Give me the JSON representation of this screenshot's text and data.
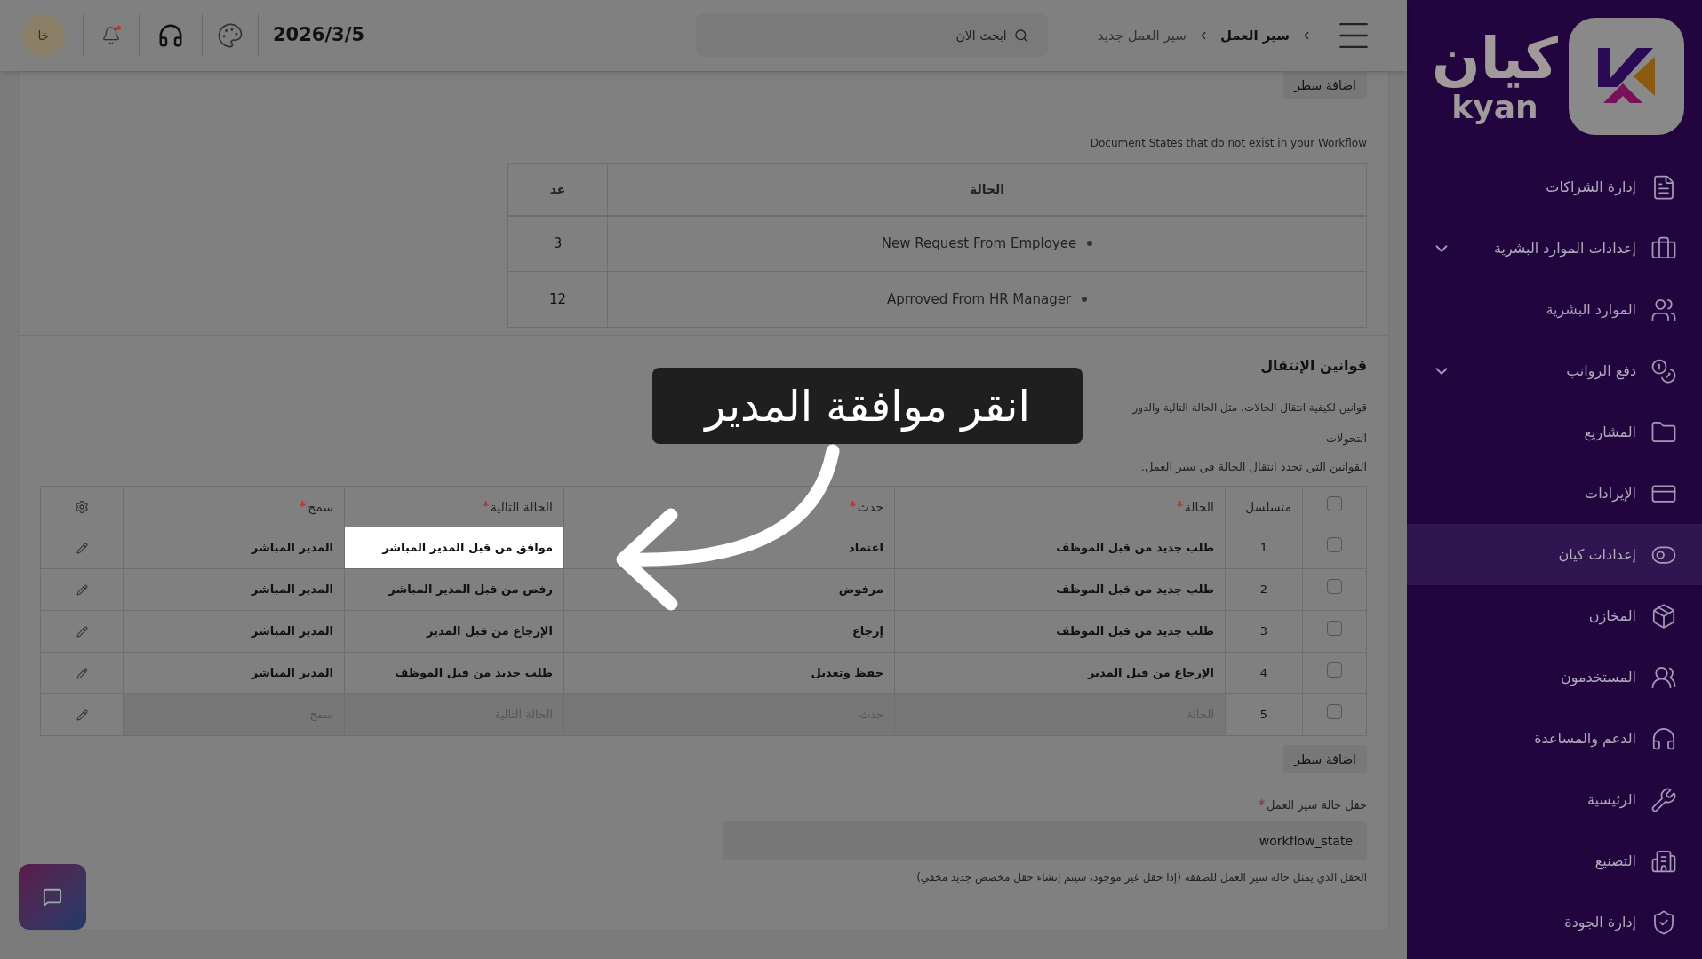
{
  "header": {
    "breadcrumb": [
      {
        "label": "سير العمل"
      },
      {
        "label": "سير العمل جديد"
      }
    ],
    "search": {
      "placeholder": "ابحث الان"
    },
    "date": "2026/3/5",
    "notification": true,
    "avatar": "خا"
  },
  "sidebar": {
    "logo_ar": "كيان",
    "logo_en": "kyan",
    "items": [
      {
        "label": "إدارة الشراكات",
        "selected": false,
        "has_submenu": false
      },
      {
        "label": "إعدادات الموارد البشرية",
        "selected": false,
        "has_submenu": true
      },
      {
        "label": "الموارد البشرية",
        "selected": false,
        "has_submenu": false
      },
      {
        "label": "دفع الرواتب",
        "selected": false,
        "has_submenu": true
      },
      {
        "label": "المشاريع",
        "selected": false,
        "has_submenu": false
      },
      {
        "label": "الإيرادات",
        "selected": false,
        "has_submenu": false
      },
      {
        "label": "إعدادات كيان",
        "selected": true,
        "has_submenu": false
      },
      {
        "label": "المخازن",
        "selected": false,
        "has_submenu": false
      },
      {
        "label": "المستخدمون",
        "selected": false,
        "has_submenu": false
      },
      {
        "label": "الدعم والمساعدة",
        "selected": false,
        "has_submenu": false
      },
      {
        "label": "الرئيسية",
        "selected": false,
        "has_submenu": false
      },
      {
        "label": "التصنيع",
        "selected": false,
        "has_submenu": false
      },
      {
        "label": "إدارة الجودة",
        "selected": false,
        "has_submenu": false
      }
    ]
  },
  "top_add_row_button": "اضافة سطر",
  "missing_states": {
    "caption": "Document States that do not exist in your Workflow",
    "columns": [
      "الحالة",
      "عد"
    ],
    "rows": [
      {
        "state": "New Request From Employee",
        "count": "3"
      },
      {
        "state": "Aprroved From HR Manager",
        "count": "12"
      }
    ]
  },
  "transition_rules": {
    "title": "قوانين الإنتقال",
    "description": "قوانين لكيفية انتقال الحالات، مثل الحالة التالية والدور",
    "subtitle": "التحولات",
    "subdescription": "القوانين التي تحدد انتقال الحالة في سير العمل.",
    "header_checkbox": {
      "checked": false
    },
    "columns": [
      {
        "label": "متسلسل",
        "required": false
      },
      {
        "label": "الحالة",
        "required": true
      },
      {
        "label": "حدث",
        "required": true
      },
      {
        "label": "الحالة التالية",
        "required": true
      },
      {
        "label": "سمح",
        "required": true
      }
    ],
    "rows": [
      {
        "kind": "row",
        "checked": false,
        "seq": "1",
        "state": "طلب جديد من قبل الموظف",
        "action": "اعتماد",
        "next_state": "موافق من قبل المدير المباشر",
        "allowed": "المدير المباشر",
        "highlighted": true
      },
      {
        "kind": "row",
        "checked": false,
        "seq": "2",
        "state": "طلب جديد من قبل الموظف",
        "action": "مرفوض",
        "next_state": "رفض من قبل المدير المباشر",
        "allowed": "المدير المباشر",
        "highlighted": false
      },
      {
        "kind": "row",
        "checked": false,
        "seq": "3",
        "state": "طلب جديد من قبل الموظف",
        "action": "إرجاع",
        "next_state": "الإرجاع من قبل المدير",
        "allowed": "المدير المباشر",
        "highlighted": false
      },
      {
        "kind": "row",
        "checked": false,
        "seq": "4",
        "state": "الإرجاع من قبل المدير",
        "action": "حفظ وتعديل",
        "next_state": "طلب جديد من قبل الموظف",
        "allowed": "المدير المباشر",
        "highlighted": false
      },
      {
        "kind": "new",
        "checked": false,
        "seq": "5",
        "placeholders": {
          "state": "الحالة",
          "action": "حدث",
          "next_state": "الحالة التالية",
          "allowed": "سمح"
        }
      }
    ],
    "add_row_button": "اضافة سطر"
  },
  "workflow_state_field": {
    "label": "حقل حالة سير العمل",
    "required": true,
    "value": "workflow_state",
    "help": "الحقل الذي يمثل حالة سير العمل للصفقة (إذا حقل غير موجود، سيتم إنشاء حقل مخصص جديد مخفي)"
  },
  "tooltip": {
    "text": "انقر موافقة المدير"
  }
}
